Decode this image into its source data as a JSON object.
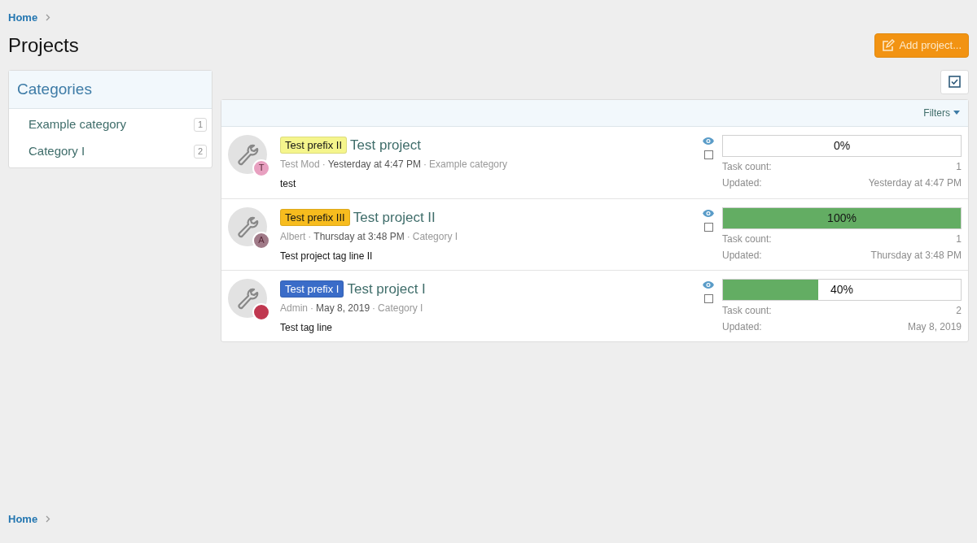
{
  "breadcrumb_top": {
    "label": "Home"
  },
  "title": "Projects",
  "add_button": {
    "label": "Add project..."
  },
  "categories": {
    "title": "Categories",
    "items": [
      {
        "label": "Example category",
        "count": "1"
      },
      {
        "label": "Category I",
        "count": "2"
      }
    ]
  },
  "filters": {
    "label": "Filters"
  },
  "projects": [
    {
      "prefix": {
        "label": "Test prefix II",
        "color": "#f5f58c"
      },
      "title": "Test project",
      "avatar": {
        "letter": "T",
        "color": "#e8a0c0"
      },
      "author": "Test Mod",
      "separator": "·",
      "date": "Yesterday at 4:47 PM",
      "category": "Example category",
      "tagline": "test",
      "level": 0,
      "percent": "0%",
      "task_count_label": "Task count:",
      "task_count": "1",
      "updated_label": "Updated:",
      "updated": "Yesterday at 4:47 PM",
      "checked": false
    },
    {
      "prefix": {
        "label": "Test prefix III",
        "color": "#f7bc1e"
      },
      "title": "Test project II",
      "avatar": {
        "letter": "A",
        "color": "#a07a88"
      },
      "author": "Albert",
      "separator": "·",
      "date": "Thursday at 3:48 PM",
      "category": "Category I",
      "tagline": "Test project tag line II",
      "level": 1,
      "percent": "100%",
      "task_count_label": "Task count:",
      "task_count": "1",
      "updated_label": "Updated:",
      "updated": "Thursday at 3:48 PM",
      "checked": false
    },
    {
      "prefix": {
        "label": "Test prefix I",
        "color": "#3a6cc8"
      },
      "title": "Test project I",
      "avatar": {
        "color": "#c03850"
      },
      "author": "Admin",
      "separator": "·",
      "date": "May 8, 2019",
      "category": "Category I",
      "tagline": "Test tag line",
      "level": 0.4,
      "percent": "40%",
      "task_count_label": "Task count:",
      "task_count": "2",
      "updated_label": "Updated:",
      "updated": "May 8, 2019",
      "checked": false
    }
  ],
  "breadcrumb_bottom": {
    "label": "Home"
  }
}
